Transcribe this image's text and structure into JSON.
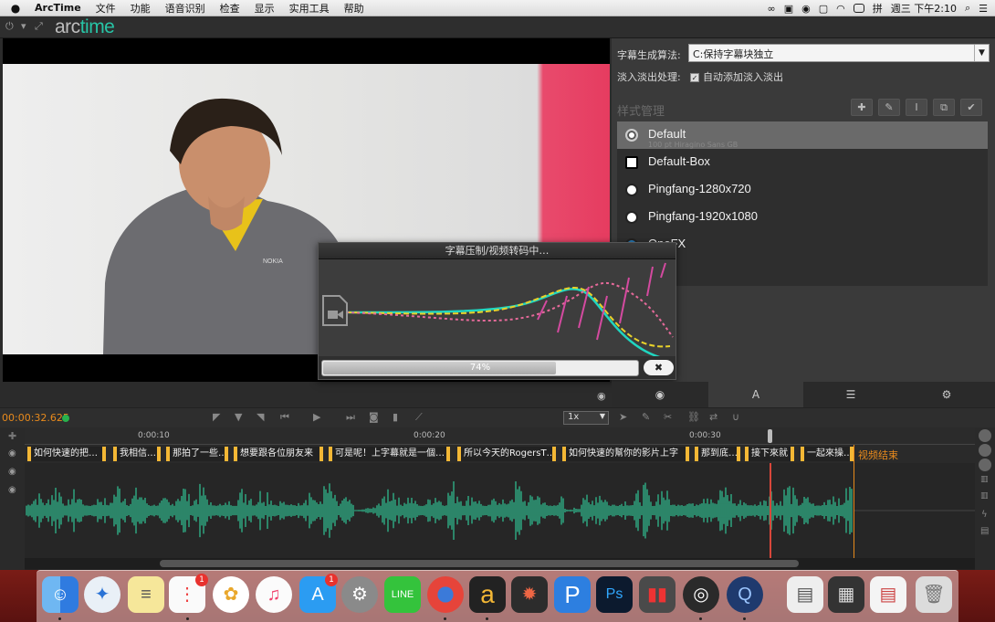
{
  "menubar": {
    "app_name": "ArcTime",
    "items": [
      "文件",
      "功能",
      "语音识别",
      "检查",
      "显示",
      "实用工具",
      "帮助"
    ],
    "clock": "週三 下午2:10"
  },
  "logo": {
    "arc": "arc",
    "time": "time"
  },
  "settings": {
    "algo_label": "字幕生成算法:",
    "algo_value": "C:保持字幕块独立",
    "fade_label": "淡入淡出处理:",
    "fade_checkbox": "自动添加淡入淡出",
    "fade_checked": true
  },
  "styles": {
    "title": "样式管理",
    "items": [
      {
        "name": "Default",
        "sub": "100 pt Hiragino Sans GB"
      },
      {
        "name": "Default-Box",
        "sub": ""
      },
      {
        "name": "Pingfang-1280x720",
        "sub": ""
      },
      {
        "name": "Pingfang-1920x1080",
        "sub": ""
      },
      {
        "name": "OneFX",
        "sub": ""
      }
    ]
  },
  "dialog": {
    "title": "字幕压制/视频转码中…",
    "progress_text": "74%",
    "progress": 0.74,
    "close": "✖"
  },
  "timeline": {
    "timecode": "00:00:32.625",
    "speed": "1x",
    "ticks": [
      "0:00:10",
      "0:00:20",
      "0:00:30"
    ],
    "subtitles": [
      "如何快速的把…",
      "我相信…",
      "那拍了一些…",
      "想要跟各位朋友来",
      "可是呢！上字幕就是一個…",
      "所以今天的RogersT…",
      "如何快速的幫你的影片上字",
      "那到底…",
      "接下來就",
      "一起來操…"
    ],
    "end_label": "视频结束"
  },
  "colors": {
    "accent": "#27c4a6",
    "timecode": "#e88a1c",
    "subtitle_border": "#f3b735",
    "waveform": "#2fae86",
    "playhead": "#d9473a"
  }
}
